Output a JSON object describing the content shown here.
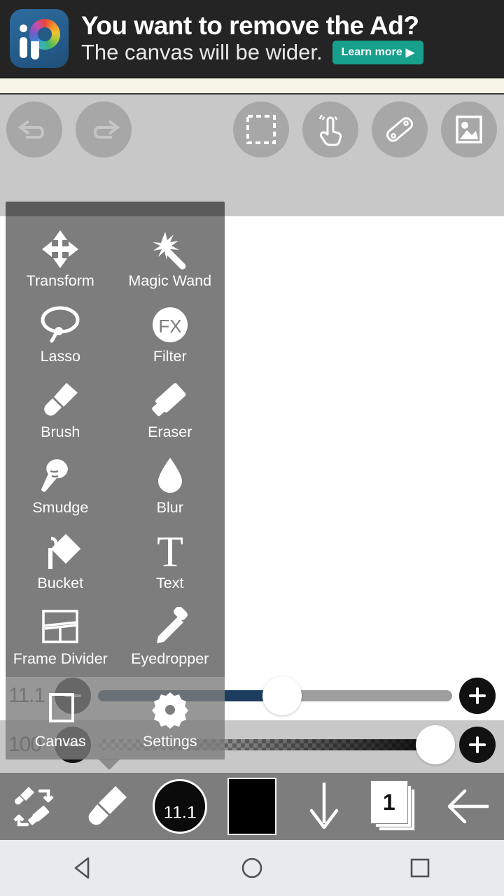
{
  "ad": {
    "line1": "You want to remove the Ad?",
    "line2": "The canvas will be wider.",
    "cta": "Learn more",
    "cta_arrow": "▶",
    "logo_name": "ibis-paint-logo"
  },
  "top_toolbar": {
    "buttons": [
      {
        "name": "undo-button",
        "icon": "undo-icon",
        "enabled": false
      },
      {
        "name": "redo-button",
        "icon": "redo-icon",
        "enabled": false
      },
      {
        "name": "selection-button",
        "icon": "selection-icon",
        "enabled": true
      },
      {
        "name": "gesture-button",
        "icon": "tap-finger-icon",
        "enabled": true
      },
      {
        "name": "ruler-button",
        "icon": "ruler-icon",
        "enabled": true
      },
      {
        "name": "photo-button",
        "icon": "photo-icon",
        "enabled": true
      }
    ]
  },
  "tool_menu": {
    "items": [
      {
        "label": "Transform",
        "icon": "move-arrows-icon"
      },
      {
        "label": "Magic Wand",
        "icon": "magic-wand-icon"
      },
      {
        "label": "Lasso",
        "icon": "lasso-icon"
      },
      {
        "label": "Filter",
        "icon": "fx-filter-icon"
      },
      {
        "label": "Brush",
        "icon": "brush-icon"
      },
      {
        "label": "Eraser",
        "icon": "eraser-icon"
      },
      {
        "label": "Smudge",
        "icon": "smudge-finger-icon"
      },
      {
        "label": "Blur",
        "icon": "water-drop-icon"
      },
      {
        "label": "Bucket",
        "icon": "paint-bucket-icon"
      },
      {
        "label": "Text",
        "icon": "text-serif-t-icon"
      },
      {
        "label": "Frame Divider",
        "icon": "frame-divider-icon"
      },
      {
        "label": "Eyedropper",
        "icon": "eyedropper-icon"
      },
      {
        "label": "Canvas",
        "icon": "canvas-icon"
      },
      {
        "label": "Settings",
        "icon": "gear-icon"
      }
    ]
  },
  "sliders": {
    "size": {
      "value": "11.1",
      "fill_percent": 52,
      "minus_label": "−",
      "plus_label": "+",
      "fill_color": "#1d3d60"
    },
    "opacity": {
      "value": "100",
      "fill_percent": 100,
      "minus_label": "−",
      "plus_label": "+"
    }
  },
  "bottom_toolbar": {
    "swap_icon": "brush-eraser-swap-icon",
    "brush_icon": "brush-icon",
    "brush_size": "11.1",
    "color_swatch": "#000000",
    "tools_arrow_icon": "down-arrow-icon",
    "layer_count": "1",
    "back_icon": "back-arrow-icon"
  },
  "android_nav": {
    "back": "back-triangle-icon",
    "home": "home-circle-icon",
    "recents": "recents-square-icon"
  },
  "colors": {
    "menu_bg": "#7d7d7d",
    "toolbar_bg": "#c8c8c8",
    "canvas_bg": "#ffffff",
    "accent_blue": "#1d3d60",
    "ad_bg": "#242424",
    "cta_green": "#17a08c"
  }
}
